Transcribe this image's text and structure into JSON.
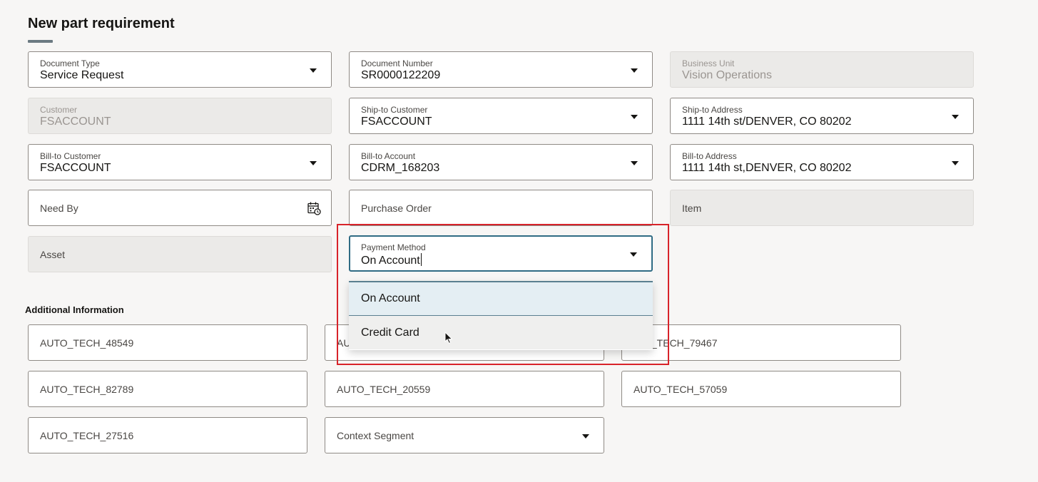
{
  "page": {
    "title": "New part requirement"
  },
  "form": {
    "document_type": {
      "label": "Document Type",
      "value": "Service Request"
    },
    "document_number": {
      "label": "Document Number",
      "value": "SR0000122209"
    },
    "business_unit": {
      "label": "Business Unit",
      "value": "Vision Operations"
    },
    "customer": {
      "label": "Customer",
      "value": "FSACCOUNT"
    },
    "ship_to_customer": {
      "label": "Ship-to Customer",
      "value": "FSACCOUNT"
    },
    "ship_to_address": {
      "label": "Ship-to Address",
      "value": "1111 14th st/DENVER, CO 80202"
    },
    "bill_to_customer": {
      "label": "Bill-to Customer",
      "value": "FSACCOUNT"
    },
    "bill_to_account": {
      "label": "Bill-to Account",
      "value": "CDRM_168203"
    },
    "bill_to_address": {
      "label": "Bill-to Address",
      "value": "1111 14th st,DENVER, CO 80202"
    },
    "need_by": {
      "placeholder": "Need By",
      "icon": "calendar-icon"
    },
    "purchase_order": {
      "placeholder": "Purchase Order"
    },
    "item": {
      "placeholder": "Item"
    },
    "asset": {
      "placeholder": "Asset"
    },
    "payment_method": {
      "label": "Payment Method",
      "value": "On Account",
      "options": [
        "On Account",
        "Credit Card"
      ],
      "selected_option": "On Account",
      "hovered_option": "Credit Card"
    }
  },
  "additional": {
    "title": "Additional Information",
    "fields": [
      "AUTO_TECH_48549",
      "AU",
      "O_TECH_79467",
      "AUTO_TECH_82789",
      "AUTO_TECH_20559",
      "AUTO_TECH_57059",
      "AUTO_TECH_27516"
    ],
    "context_segment": "Context Segment"
  },
  "colors": {
    "focus_border": "#2f6b84",
    "highlight_box": "#d8232a",
    "selected_option_bg": "#e4eef3"
  }
}
